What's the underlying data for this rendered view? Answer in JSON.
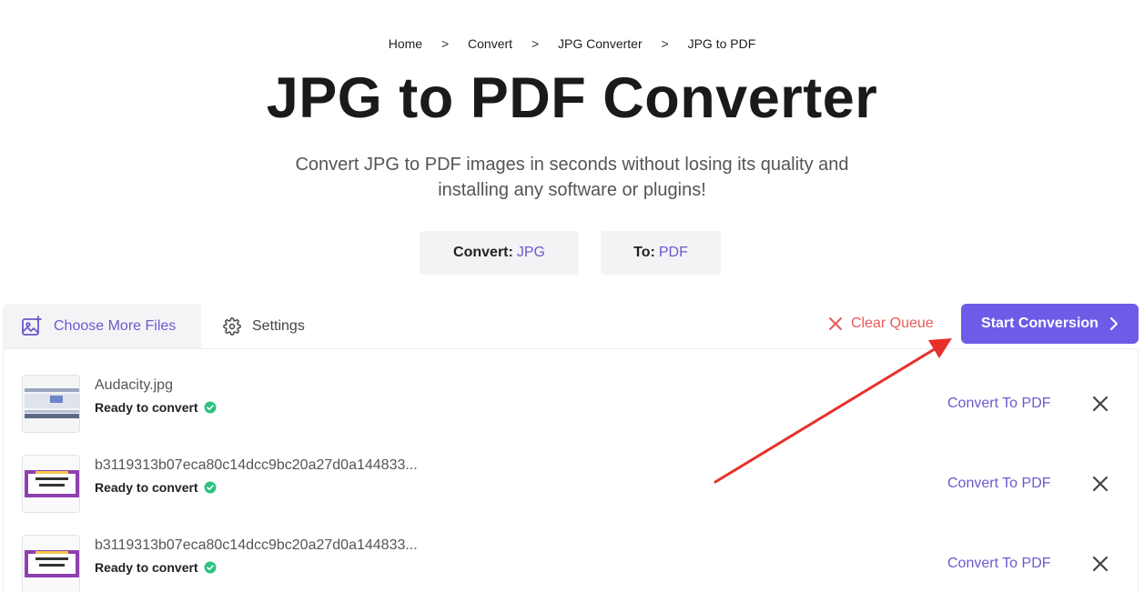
{
  "breadcrumb": {
    "items": [
      "Home",
      "Convert",
      "JPG Converter",
      "JPG to PDF"
    ],
    "separator": ">"
  },
  "page_title": "JPG to PDF Converter",
  "subtitle": "Convert JPG to PDF images in seconds without losing its quality and installing any software or plugins!",
  "format": {
    "from_label": "Convert:",
    "from_value": "JPG",
    "to_label": "To:",
    "to_value": "PDF"
  },
  "toolbar": {
    "choose_files_label": "Choose More Files",
    "settings_label": "Settings",
    "clear_queue_label": "Clear Queue",
    "start_conversion_label": "Start Conversion"
  },
  "files": [
    {
      "name": "Audacity.jpg",
      "status": "Ready to convert",
      "action": "Convert To PDF"
    },
    {
      "name": "b3119313b07eca80c14dcc9bc20a27d0a144833...",
      "status": "Ready to convert",
      "action": "Convert To PDF"
    },
    {
      "name": "b3119313b07eca80c14dcc9bc20a27d0a144833...",
      "status": "Ready to convert",
      "action": "Convert To PDF"
    }
  ],
  "colors": {
    "accent": "#6c5ce7",
    "link": "#6a5acd",
    "danger": "#e85a5a",
    "success": "#2ec27e",
    "annotation_arrow": "#e8302a"
  }
}
